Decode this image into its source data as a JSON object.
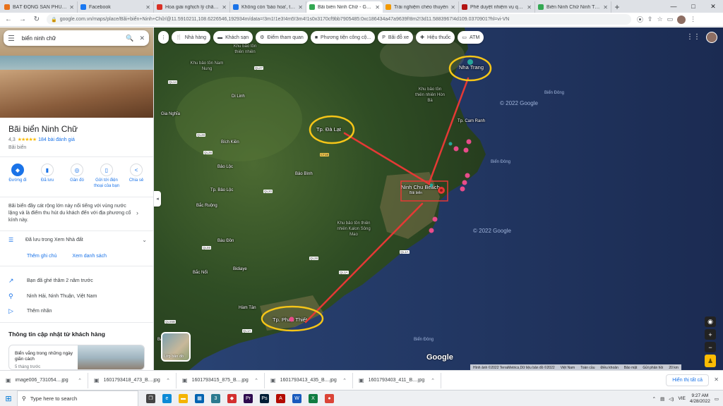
{
  "browser": {
    "tabs": [
      {
        "label": "BẤT ĐỘNG SẢN PHÚC TH",
        "favicon_color": "#e8711a",
        "active": false
      },
      {
        "label": "Facebook",
        "favicon_color": "#1877f2",
        "active": false
      },
      {
        "label": "Hoa giải nghịch lý chăm g",
        "favicon_color": "#d93025",
        "active": false
      },
      {
        "label": "Không còn 'bảo hoa', thị tr",
        "favicon_color": "#1a73e8",
        "active": false
      },
      {
        "label": "Bãi biển Ninh Chữ - Goog",
        "favicon_color": "#34a853",
        "active": true
      },
      {
        "label": "Trải nghiệm chèo thuyền",
        "favicon_color": "#f29900",
        "active": false
      },
      {
        "label": "Phê duyệt nhiệm vụ quy h",
        "favicon_color": "#b31412",
        "active": false
      },
      {
        "label": "Biển Ninh Chữ Ninh Thuậ",
        "favicon_color": "#34a853",
        "active": false
      }
    ],
    "new_tab": "+",
    "window_controls": {
      "minimize": "—",
      "maximize": "□",
      "close": "✕"
    },
    "url": "google.com.vn/maps/place/Bãi+biển+Ninh+Chữ/@11.5910211,108.6226546,192934m/data=!3m1!1e3!4m5!3m4!1s0x3170cf9bb7905485:0xc186434a47a9639f!8m2!3d11.5883967!4d109.0370901?hl=vi-VN"
  },
  "left_panel": {
    "search": {
      "value": "biển ninh chữ"
    },
    "place": {
      "title": "Bãi biển Ninh Chữ",
      "rating": "4,3",
      "stars": "★★★★★",
      "reviews": "184 bài đánh giá",
      "category": "Bãi biển"
    },
    "actions": [
      {
        "label": "Đường đi",
        "icon": "◆"
      },
      {
        "label": "Đã lưu",
        "icon": "▮"
      },
      {
        "label": "Gần đó",
        "icon": "◎"
      },
      {
        "label": "Gửi tới điện thoại của bạn",
        "icon": "▯"
      },
      {
        "label": "Chia sẻ",
        "icon": "<"
      }
    ],
    "description": "Bãi biển đầy cát rộng lớn này nổi tiếng với vùng nước lặng và là điểm thu hút du khách đến với địa phương cổ kính này.",
    "saved_list": "Đã lưu trong Xem Nhà đất",
    "links": {
      "add_note": "Thêm ghi chú",
      "view_list": "Xem danh sách"
    },
    "info": {
      "visited": "Bạn đã ghé thăm 2 năm trước",
      "address": "Ninh Hải, Ninh Thuận, Việt Nam",
      "add_label": "Thêm nhãn"
    },
    "updates": {
      "title": "Thông tin cập nhật từ khách hàng",
      "card_text": "Biển vắng trong những ngày giãn cách",
      "card_time": "5 tháng trước"
    }
  },
  "map": {
    "chips": [
      {
        "label": "Nhà hàng",
        "icon": "🍴"
      },
      {
        "label": "Khách sạn",
        "icon": "▬"
      },
      {
        "label": "Điểm tham quan",
        "icon": "⚙"
      },
      {
        "label": "Phương tiện công cộ...",
        "icon": "■"
      },
      {
        "label": "Bãi đỗ xe",
        "icon": "P"
      },
      {
        "label": "Hiệu thuốc",
        "icon": "✚"
      },
      {
        "label": "ATM",
        "icon": "▭"
      }
    ],
    "labels": {
      "nha_trang": "Nha Trang",
      "da_lat": "Tp. Đà Lạt",
      "ninh_chu": "Ninh Chu Beach",
      "phan_thiet": "Tp. Phan Thiết",
      "cam_ranh": "Tp. Cam Ranh",
      "bien_dong_1": "Biển Đông",
      "bien_dong_2": "Biển Đông",
      "bien_dong_3": "Biển Đông",
      "copyright_1": "© 2022 Google",
      "copyright_2": "© 2022 Google",
      "reserve_1": "Khu bảo tồn thiên nhiên Hòn Bà",
      "reserve_2": "Khu bảo tồn thiên nhiên Kalon Sông Mao",
      "reserve_3": "Khu bảo tồn Nam Nung",
      "reserve_4": "Khu bảo tồn thiên nhiên",
      "ninh_chu_sub": "Bãi biển",
      "towns": [
        "Gia Nghĩa",
        "Bích Kiền",
        "Di Linh",
        "Bảo Lộc",
        "Bắc Ruộng",
        "Bảo Bình",
        "Bắc Nổi",
        "Bàu Đồn",
        "Bà Rịa",
        "Bidiaye",
        "Tp. Bảo Lộc",
        "Hàm Tân"
      ],
      "roads": [
        "QL27",
        "QL14",
        "QL28",
        "QL20",
        "QL55",
        "QL1A",
        "QL1A",
        "QL28",
        "QL55B",
        "QL1A",
        "CT18",
        "QL28"
      ]
    },
    "layers_label": "Lớp bản đồ",
    "zoom": {
      "in": "+",
      "out": "−"
    },
    "logo": "Google",
    "attribution": [
      "Hình ảnh ©2022 TerraMetrics,Dữ liệu bản đồ ©2022",
      "Việt Nam",
      "Toàn cầu",
      "Điều khoản",
      "Bảo mật",
      "Gửi phản hồi",
      "20 km"
    ]
  },
  "downloads": {
    "files": [
      "image006_731054....jpg",
      "1601793418_473_B....jpg",
      "1601793415_875_B....jpg",
      "1601793413_435_B....jpg",
      "1601793403_411_B....jpg"
    ],
    "show_all": "Hiển thị tất cả"
  },
  "taskbar": {
    "search_placeholder": "Type here to search",
    "lang": "VIE",
    "time": "9:27 AM",
    "date": "4/28/2022",
    "apps": [
      {
        "name": "task-view",
        "color": "#444",
        "glyph": "❐"
      },
      {
        "name": "edge",
        "color": "#0c8ad6",
        "glyph": "e"
      },
      {
        "name": "file-explorer",
        "color": "#f4b400",
        "glyph": "▬"
      },
      {
        "name": "store",
        "color": "#0063b1",
        "glyph": "▦"
      },
      {
        "name": "app-3",
        "color": "#2b7a8f",
        "glyph": "3"
      },
      {
        "name": "app-red",
        "color": "#d32f2f",
        "glyph": "◆"
      },
      {
        "name": "premiere",
        "color": "#2d0a4e",
        "glyph": "Pr"
      },
      {
        "name": "photoshop",
        "color": "#001e36",
        "glyph": "Ps"
      },
      {
        "name": "acrobat",
        "color": "#b30b00",
        "glyph": "A"
      },
      {
        "name": "word",
        "color": "#185abd",
        "glyph": "W"
      },
      {
        "name": "excel",
        "color": "#107c41",
        "glyph": "X"
      },
      {
        "name": "chrome",
        "color": "#db4437",
        "glyph": "●"
      }
    ]
  },
  "colors": {
    "accent": "#1a73e8",
    "route": "#e53935",
    "highlight": "#f5c518",
    "rating_star": "#fbbc04"
  }
}
